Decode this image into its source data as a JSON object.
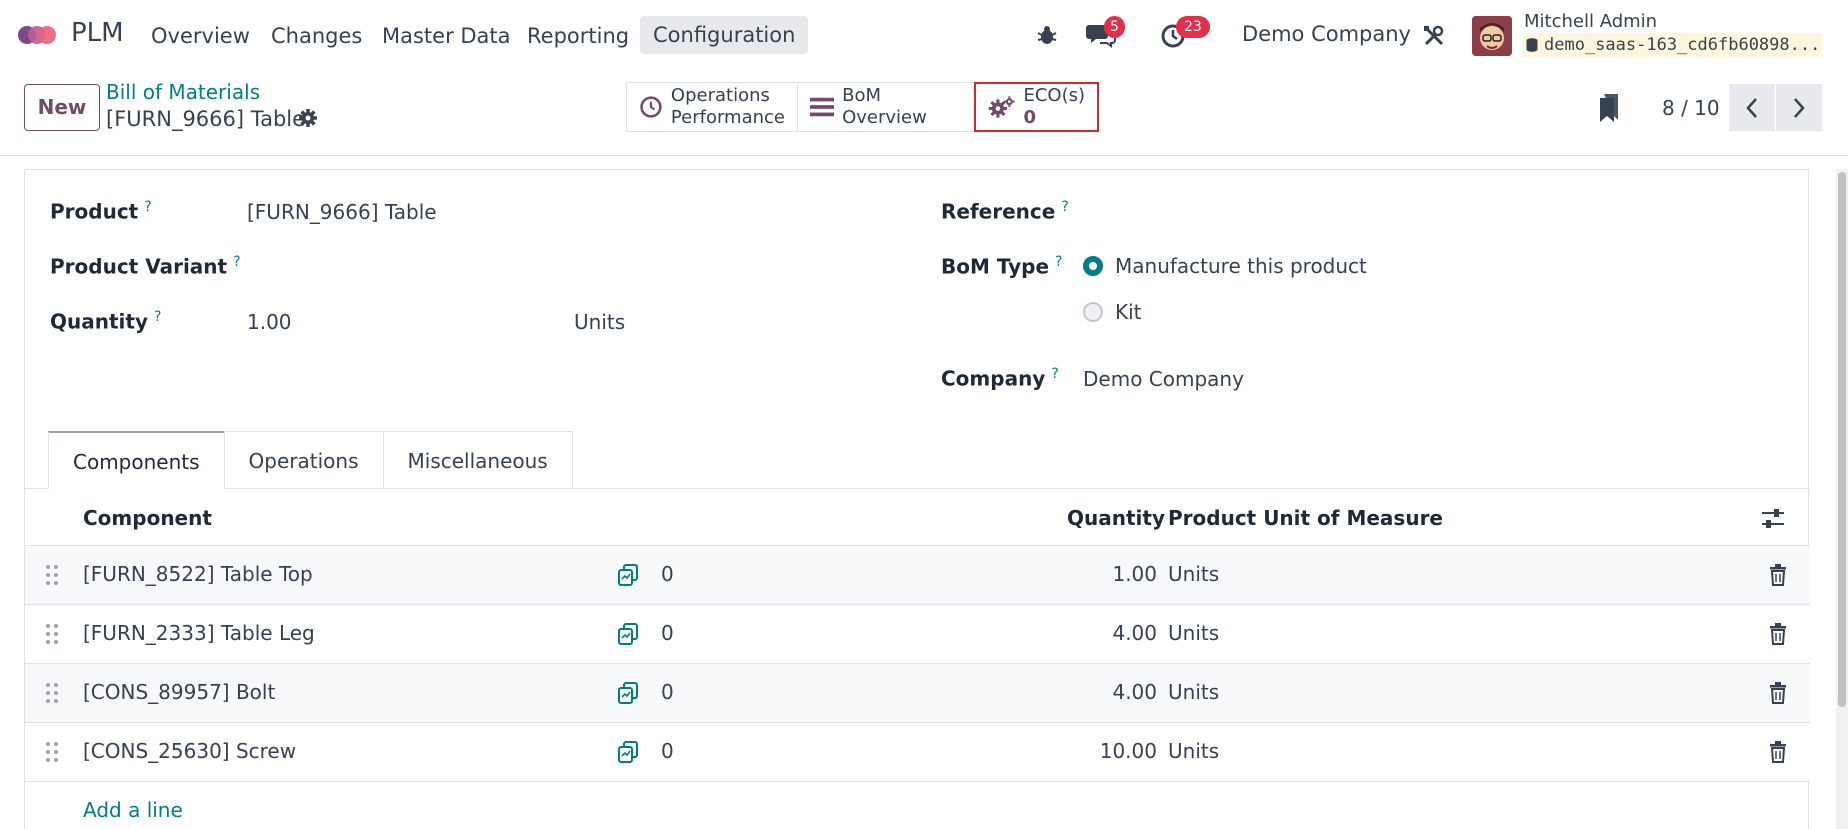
{
  "nav": {
    "app_name": "PLM",
    "menu": [
      "Overview",
      "Changes",
      "Master Data",
      "Reporting",
      "Configuration"
    ],
    "messages_badge": "5",
    "activities_badge": "23",
    "company": "Demo Company",
    "user_name": "Mitchell Admin",
    "database": "demo_saas-163_cd6fb60898..."
  },
  "control": {
    "new_label": "New",
    "breadcrumb": "Bill of Materials",
    "record_title": "[FURN_9666] Table",
    "smart_buttons": {
      "operations_line1": "Operations",
      "operations_line2": "Performance",
      "bom_overview": "BoM Overview",
      "eco_label": "ECO(s)",
      "eco_count": "0"
    },
    "pager": "8 / 10"
  },
  "form": {
    "product_label": "Product",
    "product_value": "[FURN_9666] Table",
    "variant_label": "Product Variant",
    "quantity_label": "Quantity",
    "quantity_value": "1.00",
    "quantity_uom": "Units",
    "reference_label": "Reference",
    "bom_type_label": "BoM Type",
    "bom_type_options": [
      "Manufacture this product",
      "Kit"
    ],
    "bom_type_selected": "Manufacture this product",
    "company_label": "Company",
    "company_value": "Demo Company",
    "help_marker": "?"
  },
  "tabs": [
    "Components",
    "Operations",
    "Miscellaneous"
  ],
  "components_table": {
    "headers": {
      "component": "Component",
      "quantity": "Quantity",
      "uom": "Product Unit of Measure"
    },
    "rows": [
      {
        "component": "[FURN_8522] Table Top",
        "forecast": "0",
        "quantity": "1.00",
        "uom": "Units"
      },
      {
        "component": "[FURN_2333] Table Leg",
        "forecast": "0",
        "quantity": "4.00",
        "uom": "Units"
      },
      {
        "component": "[CONS_89957] Bolt",
        "forecast": "0",
        "quantity": "4.00",
        "uom": "Units"
      },
      {
        "component": "[CONS_25630] Screw",
        "forecast": "0",
        "quantity": "10.00",
        "uom": "Units"
      }
    ],
    "add_line": "Add a line"
  },
  "colors": {
    "brand": "#714b67",
    "accent": "#017e84",
    "badge": "#e3304a",
    "highlight": "#d12b2b"
  }
}
